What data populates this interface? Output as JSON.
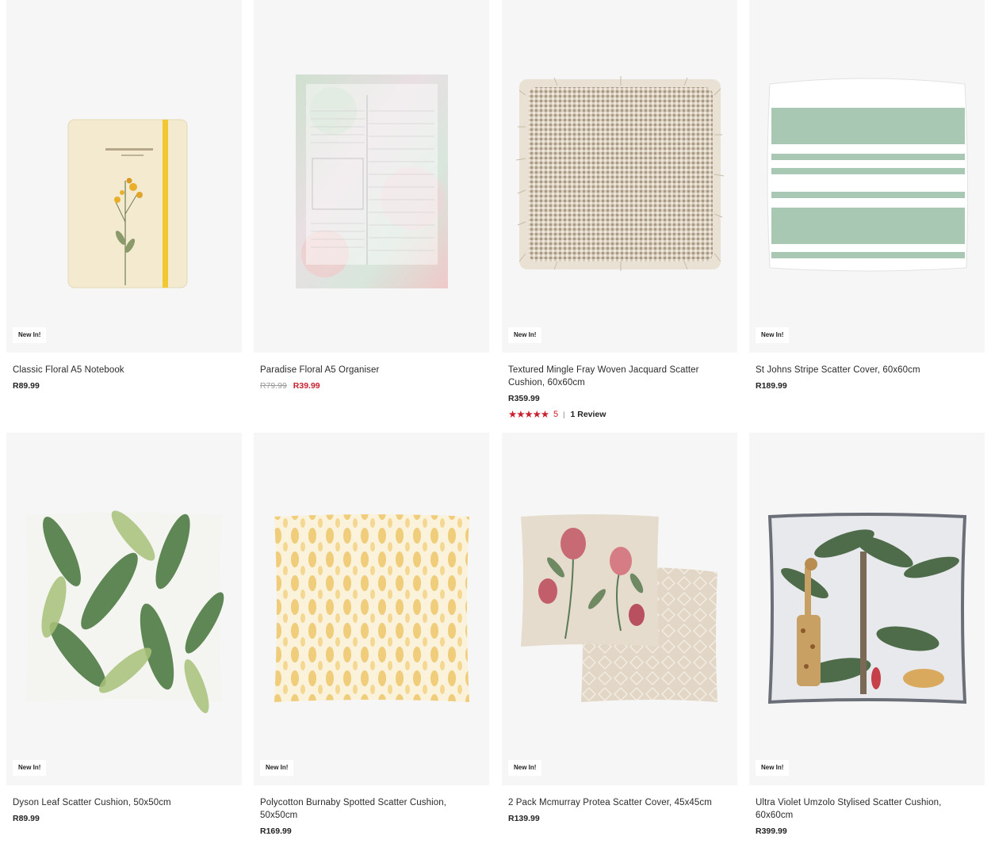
{
  "products": [
    {
      "title": "Classic Floral A5 Notebook",
      "badge": "New In!",
      "price": "R89.99",
      "image_icon": "notebook-image"
    },
    {
      "title": "Paradise Floral A5 Organiser",
      "was_price": "R79.99",
      "sale_price": "R39.99",
      "image_icon": "organiser-image"
    },
    {
      "title": "Textured Mingle Fray Woven Jacquard Scatter Cushion, 60x60cm",
      "badge": "New In!",
      "price": "R359.99",
      "rating": {
        "stars": "★★★★★",
        "value": "5",
        "separator": "|",
        "reviews": "1 Review"
      },
      "image_icon": "woven-cushion-image"
    },
    {
      "title": "St Johns Stripe Scatter Cover, 60x60cm",
      "badge": "New In!",
      "price": "R189.99",
      "image_icon": "stripe-cushion-image"
    },
    {
      "title": "Dyson Leaf Scatter Cushion, 50x50cm",
      "badge": "New In!",
      "price": "R89.99",
      "image_icon": "leaf-cushion-image"
    },
    {
      "title": "Polycotton Burnaby Spotted Scatter Cushion, 50x50cm",
      "badge": "New In!",
      "price": "R169.99",
      "image_icon": "spotted-cushion-image"
    },
    {
      "title": "2 Pack Mcmurray Protea Scatter Cover, 45x45cm",
      "badge": "New In!",
      "price": "R139.99",
      "image_icon": "protea-cushion-image"
    },
    {
      "title": "Ultra Violet Umzolo Stylised Scatter Cushion, 60x60cm",
      "badge": "New In!",
      "price": "R399.99",
      "image_icon": "jungle-cushion-image"
    }
  ],
  "colors": {
    "sale": "#c8202f",
    "image_bg": "#f6f6f6",
    "text": "#2b2b2b"
  }
}
